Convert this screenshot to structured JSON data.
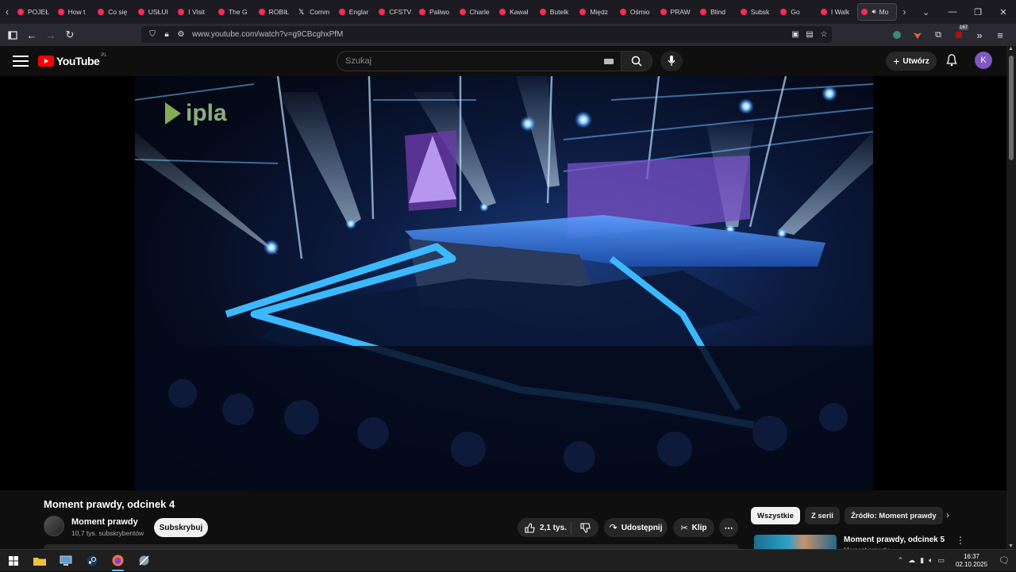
{
  "browser": {
    "tabs": [
      {
        "label": "POJEŁ",
        "icon": "youtube-icon"
      },
      {
        "label": "How t",
        "icon": "youtube-icon"
      },
      {
        "label": "Co się",
        "icon": "youtube-icon"
      },
      {
        "label": "USŁUI",
        "icon": "youtube-icon"
      },
      {
        "label": "I Visit",
        "icon": "youtube-icon"
      },
      {
        "label": "The G",
        "icon": "youtube-icon"
      },
      {
        "label": "ROBIŁ",
        "icon": "youtube-icon"
      },
      {
        "label": "Comm",
        "icon": "x-icon"
      },
      {
        "label": "Englar",
        "icon": "youtube-icon"
      },
      {
        "label": "CFSTV",
        "icon": "youtube-icon"
      },
      {
        "label": "Paliwo",
        "icon": "youtube-icon"
      },
      {
        "label": "Charle",
        "icon": "youtube-icon"
      },
      {
        "label": "Kawał",
        "icon": "youtube-icon"
      },
      {
        "label": "Butelk",
        "icon": "youtube-icon"
      },
      {
        "label": "Międz",
        "icon": "youtube-icon"
      },
      {
        "label": "Ośmio",
        "icon": "youtube-icon"
      },
      {
        "label": "PRAW",
        "icon": "youtube-icon"
      },
      {
        "label": "Blind",
        "icon": "youtube-icon"
      },
      {
        "label": "Subsk",
        "icon": "youtube-icon"
      },
      {
        "label": "Go",
        "icon": "youtube-icon"
      },
      {
        "label": "I Walk",
        "icon": "youtube-icon"
      },
      {
        "label": "Mo",
        "icon": "youtube-icon",
        "active": true
      }
    ],
    "url": "www.youtube.com/watch?v=g9CBcghxPfM",
    "extension_badge": "167"
  },
  "youtube": {
    "logo_text": "YouTube",
    "country_code": "PL",
    "search_placeholder": "Szukaj",
    "create_label": "Utwórz",
    "avatar_letter": "K",
    "video_watermark": "ipla",
    "video_title": "Moment prawdy, odcinek 4",
    "channel_name": "Moment prawdy",
    "channel_subs": "10,7 tys. subskrybentów",
    "subscribe_label": "Subskrybuj",
    "likes": "2,1 tys.",
    "share_label": "Udostępnij",
    "clip_label": "Klip",
    "chips": [
      "Wszystkie",
      "Z serii",
      "Źródło: Moment prawdy"
    ],
    "rec_title": "Moment prawdy, odcinek 5",
    "rec_channel": "Moment prawdy"
  },
  "taskbar": {
    "time": "16:37",
    "date": "02.10.2025"
  },
  "colors": {
    "yt_red": "#ff0000",
    "avatar_bg": "#7e57c2",
    "tab_favicon": "#ff2a55"
  }
}
